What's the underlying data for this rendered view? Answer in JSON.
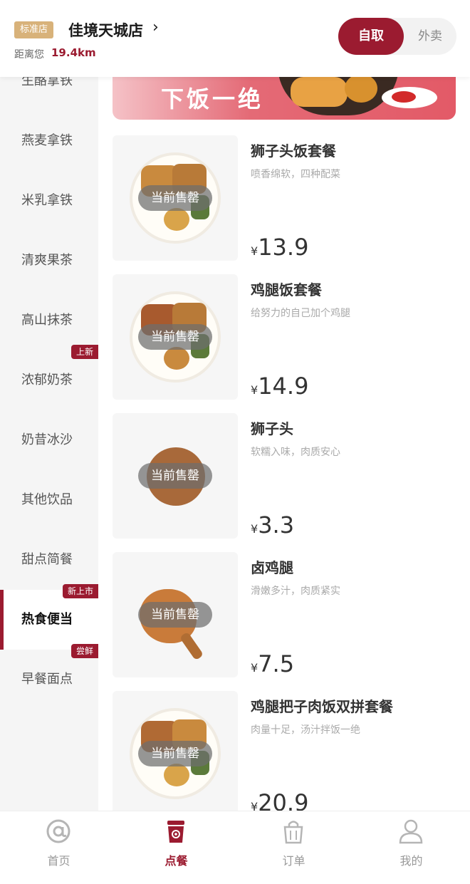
{
  "header": {
    "store_tag": "标准店",
    "store_name": "佳境天城店",
    "arrow": "›",
    "distance_label": "距离您",
    "distance_value": "19.4km",
    "mode_pickup": "自取",
    "mode_delivery": "外卖"
  },
  "sidebar": {
    "items": [
      {
        "label": "生酪拿铁",
        "badge": ""
      },
      {
        "label": "燕麦拿铁",
        "badge": ""
      },
      {
        "label": "米乳拿铁",
        "badge": ""
      },
      {
        "label": "清爽果茶",
        "badge": ""
      },
      {
        "label": "高山抹茶",
        "badge": ""
      },
      {
        "label": "浓郁奶茶",
        "badge": "上新"
      },
      {
        "label": "奶昔冰沙",
        "badge": ""
      },
      {
        "label": "其他饮品",
        "badge": ""
      },
      {
        "label": "甜点简餐",
        "badge": ""
      },
      {
        "label": "热食便当",
        "badge": "新上市",
        "active": true
      },
      {
        "label": "早餐面点",
        "badge": "尝鲜"
      }
    ]
  },
  "banner": {
    "text": "下饭一绝"
  },
  "products": [
    {
      "name": "狮子头饭套餐",
      "desc": "喷香绵软，四种配菜",
      "currency": "¥",
      "price": "13.9",
      "status": "当前售罄"
    },
    {
      "name": "鸡腿饭套餐",
      "desc": "给努力的自己加个鸡腿",
      "currency": "¥",
      "price": "14.9",
      "status": "当前售罄"
    },
    {
      "name": "狮子头",
      "desc": "软糯入味，肉质安心",
      "currency": "¥",
      "price": "3.3",
      "status": "当前售罄"
    },
    {
      "name": "卤鸡腿",
      "desc": "滑嫩多汁，肉质紧实",
      "currency": "¥",
      "price": "7.5",
      "status": "当前售罄"
    },
    {
      "name": "鸡腿把子肉饭双拼套餐",
      "desc": "肉量十足，汤汁拌饭一绝",
      "currency": "¥",
      "price": "20.9",
      "status": "当前售罄"
    }
  ],
  "tabbar": {
    "tabs": [
      {
        "label": "首页",
        "icon": "home-at-icon"
      },
      {
        "label": "点餐",
        "icon": "order-cup-icon",
        "active": true
      },
      {
        "label": "订单",
        "icon": "shopping-bag-icon"
      },
      {
        "label": "我的",
        "icon": "profile-icon"
      }
    ]
  },
  "colors": {
    "brand": "#9b1b30",
    "tag_gold": "#d8b27a",
    "sidebar_bg": "#f5f5f5"
  }
}
